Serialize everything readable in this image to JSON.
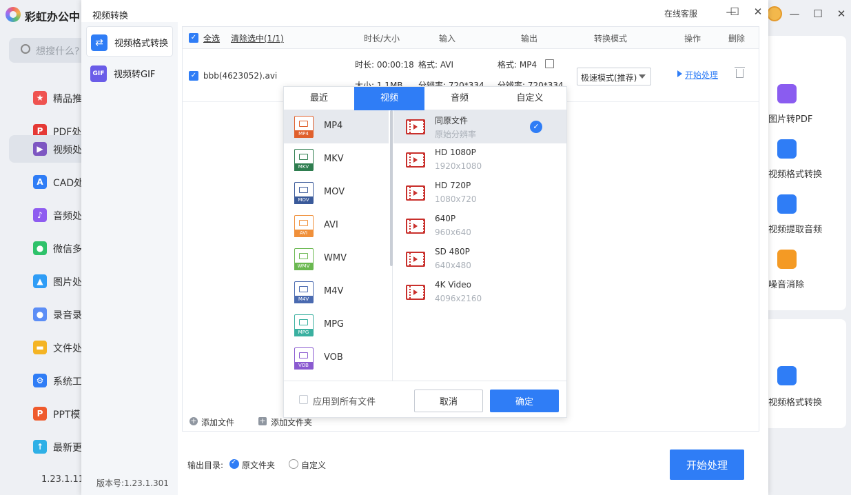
{
  "app": {
    "title": "彩虹办公中",
    "search_placeholder": "想搜什么?",
    "version": "1.23.1.11",
    "nav": [
      {
        "label": "精品推",
        "icon": "star-icon",
        "color": "#ef5350"
      },
      {
        "label": "PDF处",
        "icon": "pdf-icon",
        "color": "#e53935"
      },
      {
        "label": "视频处",
        "icon": "video-icon",
        "color": "#7e57c2"
      },
      {
        "label": "CAD处",
        "icon": "cad-icon",
        "color": "#2f7df6"
      },
      {
        "label": "音频处",
        "icon": "music-icon",
        "color": "#8e5cf0"
      },
      {
        "label": "微信多",
        "icon": "wechat-icon",
        "color": "#2ec26a"
      },
      {
        "label": "图片处",
        "icon": "image-icon",
        "color": "#2f9df6"
      },
      {
        "label": "录音录",
        "icon": "mic-icon",
        "color": "#5c8ef6"
      },
      {
        "label": "文件处",
        "icon": "folder-icon",
        "color": "#f4b424"
      },
      {
        "label": "系统工",
        "icon": "gear-icon",
        "color": "#2f7df6"
      },
      {
        "label": "PPT模",
        "icon": "ppt-icon",
        "color": "#ef5a2c"
      },
      {
        "label": "最新更",
        "icon": "update-icon",
        "color": "#2fb0e6"
      }
    ],
    "tools": [
      {
        "label": "图片转PDF"
      },
      {
        "label": "视频格式转换"
      },
      {
        "label": "视频提取音频"
      },
      {
        "label": "噪音消除"
      },
      {
        "label": "视频格式转换"
      }
    ]
  },
  "dialog": {
    "title": "视频转换",
    "service": "在线客服",
    "modes": [
      {
        "label": "视频格式转换",
        "icon": "convert-icon"
      },
      {
        "label": "视频转GIF",
        "icon": "gif-icon"
      }
    ],
    "version_text": "版本号:1.23.1.301",
    "header": {
      "select_all": "全选",
      "clear_selected": "清除选中(1/1)",
      "duration_size": "时长/大小",
      "input": "输入",
      "output": "输出",
      "convert_mode": "转换模式",
      "action": "操作",
      "delete": "删除"
    },
    "file": {
      "name": "bbb(4623052).avi",
      "duration": "时长: 00:00:18",
      "size": "大小: 1.1MB",
      "in_format": "格式: AVI",
      "in_resolution": "分辨率: 720*334",
      "out_format": "格式: MP4",
      "out_resolution": "分辨率: 720*334",
      "mode": "极速模式(推荐)",
      "start": "开始处理"
    },
    "footer": {
      "add_file": "添加文件",
      "add_folder": "添加文件夹"
    },
    "output_dir_label": "输出目录:",
    "output_original": "原文件夹",
    "output_custom": "自定义",
    "start_button": "开始处理"
  },
  "popup": {
    "tabs": [
      "最近",
      "视频",
      "音频",
      "自定义"
    ],
    "formats": [
      {
        "label": "MP4",
        "color": "#e0602c"
      },
      {
        "label": "MKV",
        "color": "#2e7d4f"
      },
      {
        "label": "MOV",
        "color": "#3a5a9a"
      },
      {
        "label": "AVI",
        "color": "#f0903a"
      },
      {
        "label": "WMV",
        "color": "#6ab850"
      },
      {
        "label": "M4V",
        "color": "#4a6ab0"
      },
      {
        "label": "MPG",
        "color": "#3ab0a0"
      },
      {
        "label": "VOB",
        "color": "#8a5ad0"
      }
    ],
    "resolutions": [
      {
        "name": "同原文件",
        "sub": "原始分辨率"
      },
      {
        "name": "HD 1080P",
        "sub": "1920x1080"
      },
      {
        "name": "HD 720P",
        "sub": "1080x720"
      },
      {
        "name": "640P",
        "sub": "960x640"
      },
      {
        "name": "SD 480P",
        "sub": "640x480"
      },
      {
        "name": "4K Video",
        "sub": "4096x2160"
      }
    ],
    "apply_all": "应用到所有文件",
    "cancel": "取消",
    "ok": "确定"
  }
}
